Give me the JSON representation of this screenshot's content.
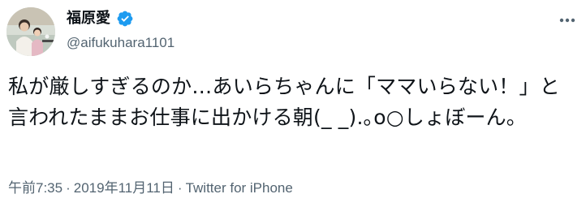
{
  "tweet": {
    "display_name": "福原愛",
    "verified_icon": "verified-badge-icon",
    "verified_color": "#1d9bf0",
    "handle": "@aifukuhara1101",
    "text": "私が厳しすぎるのか…あいらちゃんに「ママいらない！」と言われたままお仕事に出かける朝(_ _).｡o○しょぼーん。",
    "time": "午前7:35",
    "separator": "·",
    "date": "2019年11月11日",
    "source": "Twitter for iPhone",
    "more_icon": "more-options-icon",
    "avatar_icon": "profile-avatar"
  },
  "colors": {
    "text_primary": "#0f1419",
    "text_secondary": "#536471",
    "background": "#ffffff"
  }
}
